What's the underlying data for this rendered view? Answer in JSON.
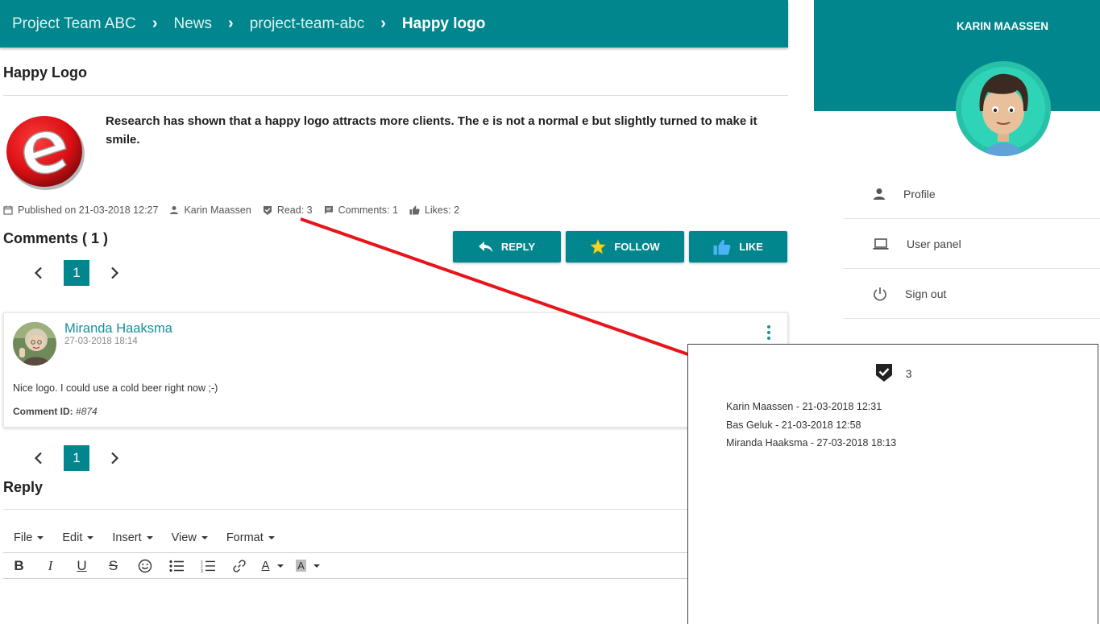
{
  "breadcrumb": [
    "Project Team ABC",
    "News",
    "project-team-abc",
    "Happy logo"
  ],
  "article": {
    "title": "Happy Logo",
    "body": "Research has shown that a happy logo attracts more clients. The e is not a normal e but slightly turned to make it smile.",
    "published": "Published on 21-03-2018 12:27",
    "author": "Karin Maassen",
    "read": "Read: 3",
    "comments": "Comments: 1",
    "likes": "Likes: 2"
  },
  "comments_section": {
    "title": "Comments ( 1 )",
    "page": "1"
  },
  "actions": {
    "reply": "REPLY",
    "follow": "FOLLOW",
    "like": "LIKE"
  },
  "comment": {
    "author": "Miranda Haaksma",
    "time": "27-03-2018 18:14",
    "text": "Nice logo. I could use a cold beer right now ;-)",
    "id_label": "Comment ID:",
    "id_value": "#874"
  },
  "reply": {
    "title": "Reply",
    "menus": [
      "File",
      "Edit",
      "Insert",
      "View",
      "Format"
    ]
  },
  "sidebar": {
    "user": "KARIN MAASSEN",
    "items": [
      "Profile",
      "User panel",
      "Sign out"
    ]
  },
  "popup": {
    "count": "3",
    "readers": [
      "Karin Maassen - 21-03-2018 12:31",
      "Bas Geluk - 21-03-2018 12:58",
      "Miranda Haaksma - 27-03-2018 18:13"
    ]
  },
  "colors": {
    "teal": "#00868c",
    "arrow": "#e8141a",
    "name_link": "#178f9a"
  }
}
